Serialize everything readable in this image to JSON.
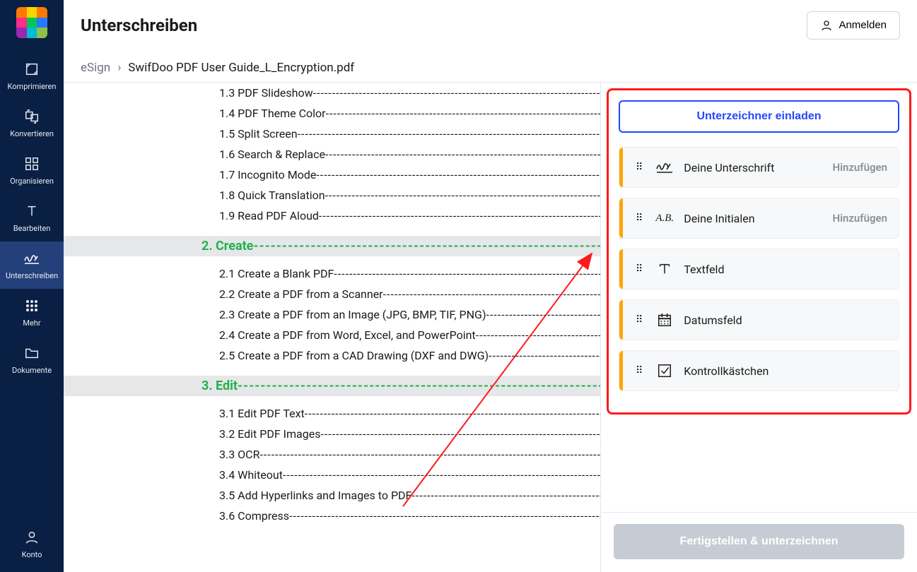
{
  "header": {
    "page_title": "Unterschreiben",
    "login_label": "Anmelden"
  },
  "breadcrumb": {
    "root": "eSign",
    "sep": "›",
    "file": "SwifDoo PDF User Guide_L_Encryption.pdf"
  },
  "sidebar": {
    "items": [
      {
        "label": "Komprimieren",
        "icon": "compress-icon"
      },
      {
        "label": "Konvertieren",
        "icon": "convert-icon"
      },
      {
        "label": "Organisieren",
        "icon": "organize-icon"
      },
      {
        "label": "Bearbeiten",
        "icon": "edit-text-icon"
      },
      {
        "label": "Unterschreiben",
        "icon": "sign-icon"
      },
      {
        "label": "Mehr",
        "icon": "more-icon"
      },
      {
        "label": "Dokumente",
        "icon": "folder-icon"
      }
    ],
    "account": {
      "label": "Konto",
      "icon": "account-icon"
    }
  },
  "document": {
    "lines": [
      {
        "type": "item",
        "text": "1.3 PDF Slideshow"
      },
      {
        "type": "item",
        "text": "1.4 PDF Theme Color"
      },
      {
        "type": "item",
        "text": "1.5 Split Screen"
      },
      {
        "type": "item",
        "text": "1.6 Search & Replace"
      },
      {
        "type": "item",
        "text": "1.7 Incognito Mode"
      },
      {
        "type": "item",
        "text": "1.8 Quick Translation"
      },
      {
        "type": "item",
        "text": "1.9 Read PDF Aloud"
      },
      {
        "type": "section",
        "text": "2. Create"
      },
      {
        "type": "item",
        "text": "2.1 Create a Blank PDF"
      },
      {
        "type": "item",
        "text": "2.2 Create a PDF from a Scanner"
      },
      {
        "type": "item",
        "text": "2.3 Create a PDF from an Image (JPG, BMP, TIF, PNG)"
      },
      {
        "type": "item",
        "text": "2.4 Create a PDF from Word, Excel, and PowerPoint"
      },
      {
        "type": "item",
        "text": "2.5 Create a PDF from a CAD Drawing (DXF and DWG)"
      },
      {
        "type": "section",
        "text": "3. Edit"
      },
      {
        "type": "item",
        "text": "3.1 Edit PDF Text"
      },
      {
        "type": "item",
        "text": "3.2 Edit PDF Images"
      },
      {
        "type": "item",
        "text": "3.3 OCR"
      },
      {
        "type": "item",
        "text": "3.4 Whiteout"
      },
      {
        "type": "item",
        "text": "3.5 Add Hyperlinks and Images to PDF"
      },
      {
        "type": "item",
        "text": "3.6 Compress"
      }
    ]
  },
  "rightPanel": {
    "invite_label": "Unterzeichner einladen",
    "fields": [
      {
        "label": "Deine Unterschrift",
        "action": "Hinzufügen",
        "icon": "signature"
      },
      {
        "label": "Deine Initialen",
        "action": "Hinzufügen",
        "icon": "initials"
      },
      {
        "label": "Textfeld",
        "action": "",
        "icon": "text"
      },
      {
        "label": "Datumsfeld",
        "action": "",
        "icon": "date"
      },
      {
        "label": "Kontrollkästchen",
        "action": "",
        "icon": "checkbox"
      }
    ],
    "finish_label": "Fertigstellen & unterzeichnen"
  },
  "colors": {
    "sidebar_bg": "#0a1f44",
    "accent_blue": "#2447ff",
    "section_green": "#22b14c",
    "annotation_red": "#ff1a1a",
    "accent_orange": "#ffa500"
  }
}
